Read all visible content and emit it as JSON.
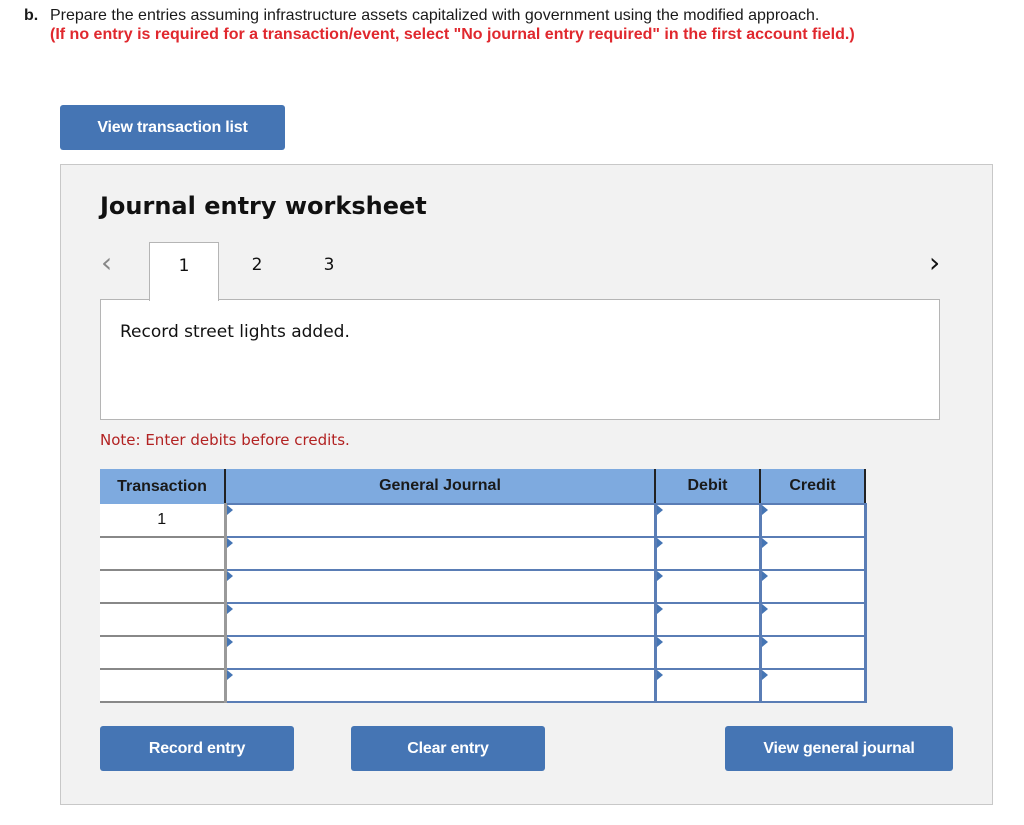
{
  "instructions": {
    "part_label": "b.",
    "main_text": "Prepare the entries assuming infrastructure assets capitalized with government using the modified approach.",
    "note_text": "(If no entry is required for a transaction/event, select \"No journal entry required\" in the first account field.)"
  },
  "buttons": {
    "view_transaction_list": "View transaction list",
    "record_entry": "Record entry",
    "clear_entry": "Clear entry",
    "view_general_journal": "View general journal"
  },
  "worksheet": {
    "title": "Journal entry worksheet",
    "nav_prev_icon": "chevron-left-icon",
    "nav_next_icon": "chevron-right-icon",
    "tabs": [
      {
        "label": "1",
        "active": true
      },
      {
        "label": "2",
        "active": false
      },
      {
        "label": "3",
        "active": false
      }
    ],
    "description": "Record street lights added.",
    "note": "Note: Enter debits before credits."
  },
  "table": {
    "headers": [
      "Transaction",
      "General Journal",
      "Debit",
      "Credit"
    ],
    "rows": [
      {
        "transaction": "1",
        "account": "",
        "debit": "",
        "credit": ""
      },
      {
        "transaction": "",
        "account": "",
        "debit": "",
        "credit": ""
      },
      {
        "transaction": "",
        "account": "",
        "debit": "",
        "credit": ""
      },
      {
        "transaction": "",
        "account": "",
        "debit": "",
        "credit": ""
      },
      {
        "transaction": "",
        "account": "",
        "debit": "",
        "credit": ""
      },
      {
        "transaction": "",
        "account": "",
        "debit": "",
        "credit": ""
      }
    ]
  },
  "colors": {
    "button_bg": "#4575b4",
    "header_bg": "#7eaadf",
    "instruction_red": "#e0282e",
    "note_red": "#b22222",
    "panel_bg": "#f2f2f2"
  }
}
